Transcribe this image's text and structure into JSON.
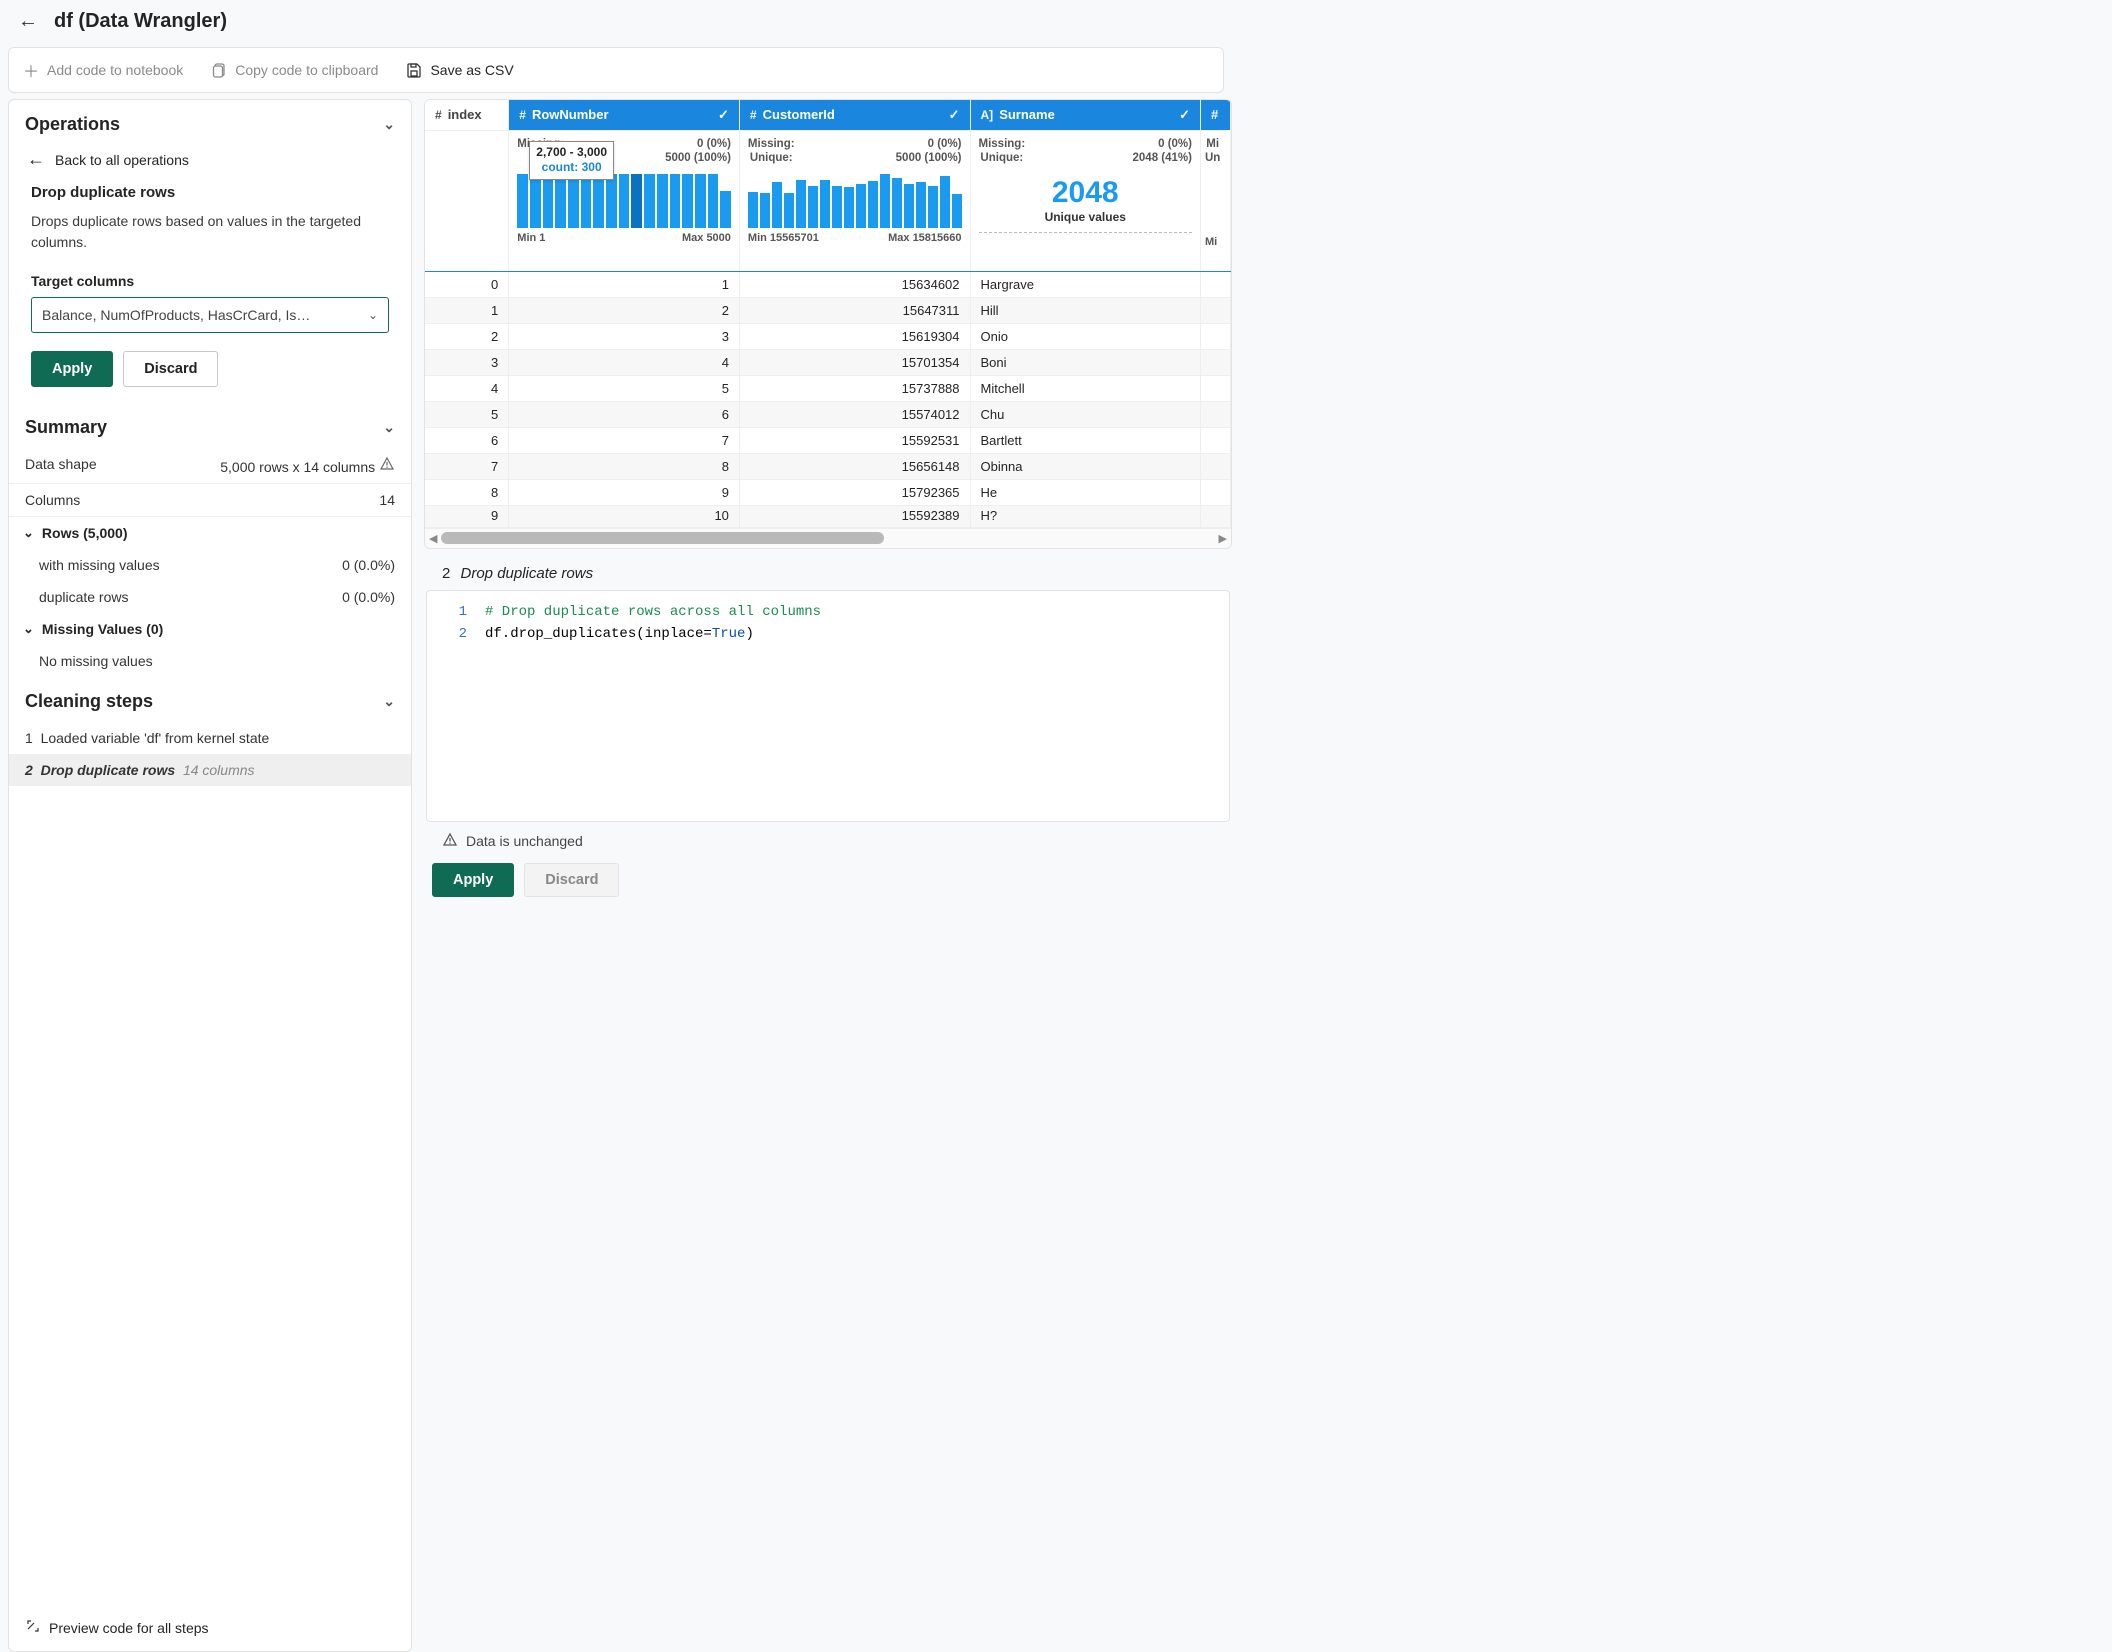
{
  "titlebar": {
    "title": "df (Data Wrangler)"
  },
  "toolbar": {
    "add_code": "Add code to notebook",
    "copy_code": "Copy code to clipboard",
    "save_csv": "Save as CSV"
  },
  "operations": {
    "heading": "Operations",
    "back": "Back to all operations",
    "title": "Drop duplicate rows",
    "desc": "Drops duplicate rows based on values in the targeted columns.",
    "target_label": "Target columns",
    "target_value": "Balance, NumOfProducts, HasCrCard, Is…",
    "apply": "Apply",
    "discard": "Discard"
  },
  "summary": {
    "heading": "Summary",
    "shape_label": "Data shape",
    "shape_value": "5,000 rows x 14 columns",
    "columns_label": "Columns",
    "columns_value": "14",
    "rows_head": "Rows (5,000)",
    "missing_label": "with missing values",
    "missing_value": "0 (0.0%)",
    "dup_label": "duplicate rows",
    "dup_value": "0 (0.0%)",
    "mv_head": "Missing Values (0)",
    "mv_none": "No missing values"
  },
  "cleaning": {
    "heading": "Cleaning steps",
    "step1_num": "1",
    "step1_text": "Loaded variable 'df' from kernel state",
    "step2_num": "2",
    "step2_text": "Drop duplicate rows",
    "step2_meta": "14 columns",
    "preview": "Preview code for all steps"
  },
  "grid": {
    "index_header": "index",
    "columns": [
      {
        "name": "RowNumber",
        "type": "#",
        "missing": "0 (0%)",
        "unique": "5000 (100%)",
        "min": "Min 1",
        "max": "Max 5000",
        "tooltip_range": "2,700 - 3,000",
        "tooltip_count": "count: 300"
      },
      {
        "name": "CustomerId",
        "type": "#",
        "missing": "0 (0%)",
        "unique": "5000 (100%)",
        "min": "Min 15565701",
        "max": "Max 15815660"
      },
      {
        "name": "Surname",
        "type": "A]",
        "missing": "0 (0%)",
        "unique": "2048 (41%)",
        "big": "2048",
        "big_label": "Unique values"
      }
    ],
    "labels": {
      "missing": "Missing:",
      "unique": "Unique:",
      "miss_short": "Mi",
      "un_short": "Un",
      "min_short": "Mi"
    },
    "rows": [
      {
        "idx": "0",
        "c0": "1",
        "c1": "15634602",
        "c2": "Hargrave"
      },
      {
        "idx": "1",
        "c0": "2",
        "c1": "15647311",
        "c2": "Hill"
      },
      {
        "idx": "2",
        "c0": "3",
        "c1": "15619304",
        "c2": "Onio"
      },
      {
        "idx": "3",
        "c0": "4",
        "c1": "15701354",
        "c2": "Boni"
      },
      {
        "idx": "4",
        "c0": "5",
        "c1": "15737888",
        "c2": "Mitchell"
      },
      {
        "idx": "5",
        "c0": "6",
        "c1": "15574012",
        "c2": "Chu"
      },
      {
        "idx": "6",
        "c0": "7",
        "c1": "15592531",
        "c2": "Bartlett"
      },
      {
        "idx": "7",
        "c0": "8",
        "c1": "15656148",
        "c2": "Obinna"
      },
      {
        "idx": "8",
        "c0": "9",
        "c1": "15792365",
        "c2": "He"
      },
      {
        "idx": "9",
        "c0": "10",
        "c1": "15592389",
        "c2": "H?"
      }
    ]
  },
  "code": {
    "step_num": "2",
    "step_name": "Drop duplicate rows",
    "line1_ln": "1",
    "line1": "# Drop duplicate rows across all columns",
    "line2_ln": "2",
    "line2_a": "df.drop_duplicates(inplace=",
    "line2_b": "True",
    "line2_c": ")",
    "status": "Data is unchanged",
    "apply": "Apply",
    "discard": "Discard"
  },
  "chart_data": [
    {
      "type": "bar",
      "column": "RowNumber",
      "x_range": [
        1,
        5000
      ],
      "bin_width": 300,
      "values": [
        300,
        300,
        300,
        300,
        300,
        300,
        300,
        300,
        300,
        300,
        300,
        300,
        300,
        300,
        300,
        300,
        200
      ],
      "tooltip_bin": "2,700 - 3,000",
      "tooltip_count": 300
    },
    {
      "type": "bar",
      "column": "CustomerId",
      "x_range": [
        15565701,
        15815660
      ],
      "bins": 18,
      "values_est": [
        240,
        230,
        300,
        235,
        315,
        280,
        320,
        280,
        270,
        295,
        310,
        355,
        330,
        290,
        300,
        280,
        345,
        225
      ],
      "note": "heights estimated from chart; each ~250-360 rows"
    },
    {
      "type": "table",
      "column": "Surname",
      "unique_values": 2048,
      "unique_pct": 41
    }
  ]
}
